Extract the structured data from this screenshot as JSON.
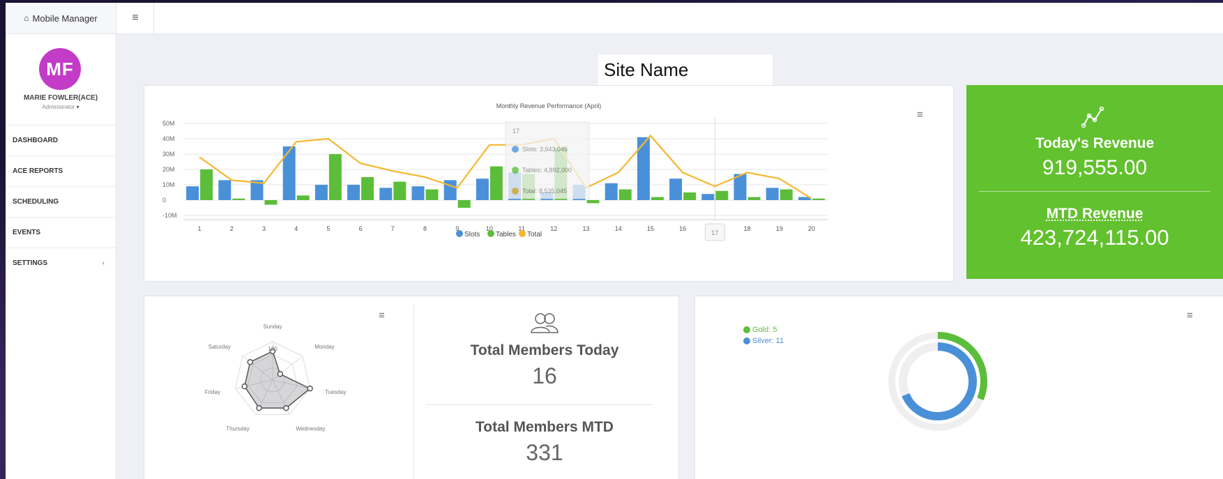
{
  "app": {
    "brand": "Mobile Manager",
    "site_name": "Site Name"
  },
  "user": {
    "initials": "MF",
    "name": "MARIE FOWLER(ACE)",
    "role": "Administrator"
  },
  "nav": [
    "DASHBOARD",
    "ACE REPORTS",
    "SCHEDULING",
    "EVENTS",
    "SETTINGS"
  ],
  "revenue": {
    "today_label": "Today's Revenue",
    "today_value": "919,555.00",
    "mtd_label": "MTD Revenue",
    "mtd_value": "423,724,115.00"
  },
  "members": {
    "today_label": "Total Members Today",
    "today_value": "16",
    "mtd_label": "Total Members MTD",
    "mtd_value": "331"
  },
  "colors": {
    "slots": "#4a90d9",
    "tables": "#5cbd3a",
    "total": "#f5b731",
    "green_card": "#62c12e",
    "gold": "#5cbd3a",
    "silver": "#4a90d9"
  },
  "chart_data": [
    {
      "type": "bar",
      "title": "Monthly Revenue Performance (April)",
      "categories": [
        "1",
        "2",
        "3",
        "4",
        "5",
        "6",
        "7",
        "8",
        "9",
        "10",
        "11",
        "12",
        "13",
        "14",
        "15",
        "16",
        "17",
        "18",
        "19",
        "20"
      ],
      "y_tick_labels": [
        "50M",
        "40M",
        "30M",
        "20M",
        "10M",
        "0",
        "-10M"
      ],
      "ylim": [
        -10,
        50
      ],
      "series": [
        {
          "name": "Slots",
          "type": "bar",
          "values": [
            9,
            13,
            13,
            35,
            10,
            10,
            8,
            9,
            13,
            14,
            18,
            5,
            10,
            11,
            41,
            14,
            4,
            17,
            8,
            2
          ]
        },
        {
          "name": "Tables",
          "type": "bar",
          "values": [
            20,
            1,
            -3,
            3,
            30,
            15,
            12,
            7,
            -5,
            22,
            17,
            34,
            -2,
            7,
            2,
            5,
            6,
            2,
            7,
            1
          ]
        },
        {
          "name": "Total",
          "type": "line",
          "values": [
            28,
            13,
            11,
            38,
            40,
            24,
            19,
            15,
            8,
            36,
            36,
            40,
            8,
            18,
            42,
            18,
            9,
            18,
            14,
            1
          ]
        }
      ],
      "tooltip": {
        "header": "17",
        "rows": [
          {
            "name": "Slots",
            "value": "3,643,045"
          },
          {
            "name": "Tables",
            "value": "4,892,000"
          },
          {
            "name": "Total",
            "value": "8,535,045"
          }
        ],
        "crosshair_label": "17"
      }
    },
    {
      "type": "radar",
      "categories": [
        "Sunday",
        "Monday",
        "Tuesday",
        "Wednesday",
        "Thursday",
        "Friday",
        "Saturday"
      ],
      "values": [
        120,
        40,
        160,
        130,
        130,
        120,
        120
      ],
      "center_tick_label": "120"
    },
    {
      "type": "pie",
      "series": [
        {
          "name": "Gold",
          "value": 5,
          "label": "Gold: 5"
        },
        {
          "name": "Silver",
          "value": 11,
          "label": "Silver: 11"
        }
      ]
    }
  ]
}
